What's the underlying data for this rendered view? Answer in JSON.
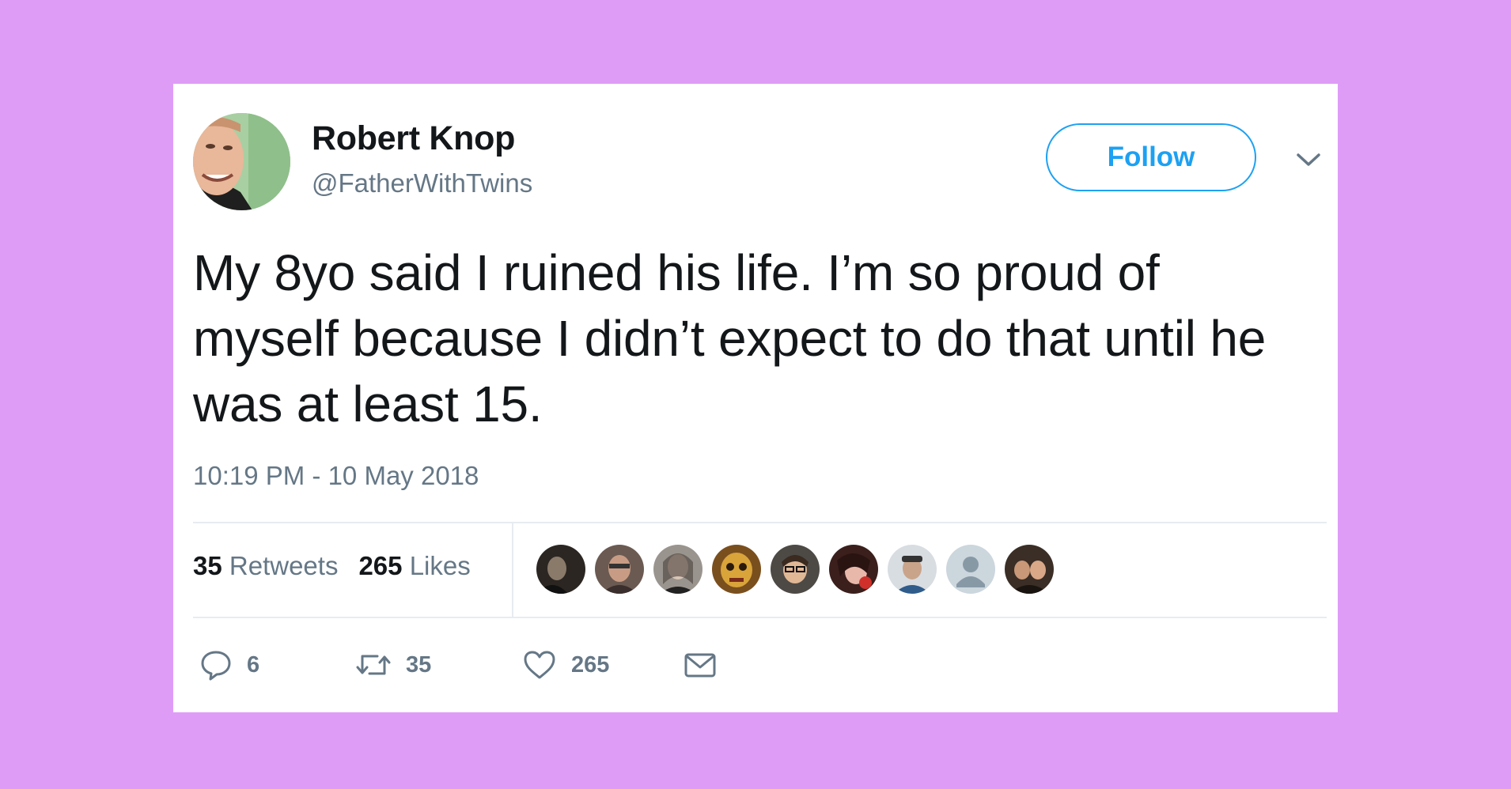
{
  "author": {
    "name": "Robert Knop",
    "handle": "@FatherWithTwins"
  },
  "follow_button": {
    "label": "Follow"
  },
  "tweet": {
    "text": "My 8yo said I ruined his life. I’m so proud of myself because I didn’t expect to do that until he was at least 15.",
    "timestamp": "10:19 PM - 10 May 2018"
  },
  "stats": {
    "retweets_count": "35",
    "retweets_label": "Retweets",
    "likes_count": "265",
    "likes_label": "Likes"
  },
  "liker_avatars": [
    "avatar-1",
    "avatar-2",
    "avatar-3",
    "avatar-4",
    "avatar-5",
    "avatar-6",
    "avatar-7",
    "avatar-8",
    "avatar-9"
  ],
  "actions": {
    "reply_count": "6",
    "retweet_count": "35",
    "like_count": "265"
  },
  "icons": {
    "reply": "reply-icon",
    "retweet": "retweet-icon",
    "like": "heart-icon",
    "dm": "envelope-icon",
    "more": "chevron-down-icon"
  },
  "colors": {
    "background": "#df9cf7",
    "card": "#ffffff",
    "accent": "#1da1f2",
    "text_primary": "#14171a",
    "text_secondary": "#657786",
    "divider": "#e6ecf0"
  }
}
